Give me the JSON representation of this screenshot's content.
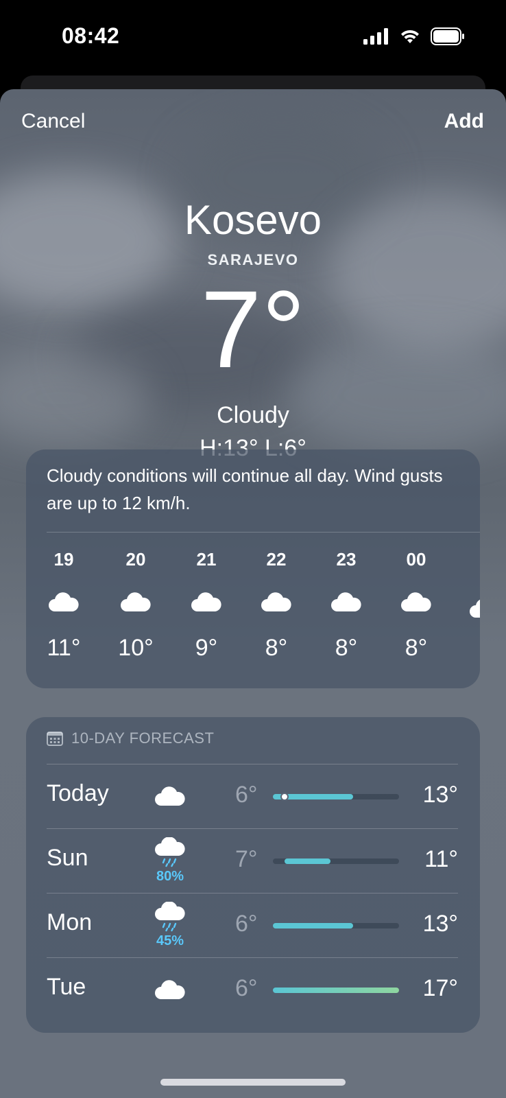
{
  "status_bar": {
    "time": "08:42",
    "icons": [
      "signal-icon",
      "wifi-icon",
      "battery-icon"
    ]
  },
  "nav": {
    "cancel_label": "Cancel",
    "add_label": "Add"
  },
  "location": {
    "city": "Kosevo",
    "region": "SARAJEVO"
  },
  "current": {
    "temperature": "7°",
    "condition": "Cloudy",
    "high_low": "H:13°  L:6°"
  },
  "hourly": {
    "summary": "Cloudy conditions will continue all day. Wind gusts are up to 12 km/h.",
    "hours": [
      {
        "hour": "19",
        "icon": "cloud-icon",
        "temp": "11°"
      },
      {
        "hour": "20",
        "icon": "cloud-icon",
        "temp": "10°"
      },
      {
        "hour": "21",
        "icon": "cloud-icon",
        "temp": "9°"
      },
      {
        "hour": "22",
        "icon": "cloud-icon",
        "temp": "8°"
      },
      {
        "hour": "23",
        "icon": "cloud-icon",
        "temp": "8°"
      },
      {
        "hour": "00",
        "icon": "cloud-icon",
        "temp": "8°"
      }
    ]
  },
  "forecast": {
    "header": "10-DAY FORECAST",
    "header_icon": "calendar-icon",
    "days": [
      {
        "day": "Today",
        "icon": "cloud-icon",
        "precip": "",
        "low": "6°",
        "high": "13°",
        "range_low": 6,
        "range_high": 13,
        "current": 7
      },
      {
        "day": "Sun",
        "icon": "cloud-rain-icon",
        "precip": "80%",
        "low": "7°",
        "high": "11°",
        "range_low": 7,
        "range_high": 11
      },
      {
        "day": "Mon",
        "icon": "cloud-rain-icon",
        "precip": "45%",
        "low": "6°",
        "high": "13°",
        "range_low": 6,
        "range_high": 13
      },
      {
        "day": "Tue",
        "icon": "cloud-icon",
        "precip": "",
        "low": "6°",
        "high": "17°",
        "range_low": 6,
        "range_high": 17
      }
    ],
    "scale_min": 6,
    "scale_max": 17
  },
  "colors": {
    "bar_cool": "#5bc6d4",
    "bar_warm": "#8fd6a0",
    "precip": "#5ac8fa"
  }
}
